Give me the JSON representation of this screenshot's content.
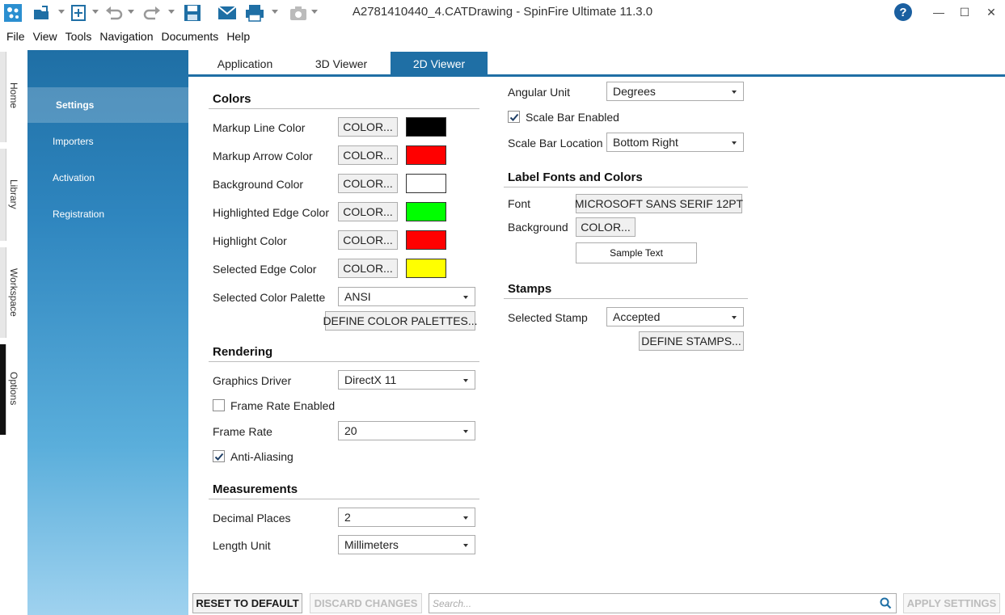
{
  "window": {
    "title": "A2781410440_4.CATDrawing - SpinFire Ultimate 11.3.0",
    "help": "?",
    "minimize": "—",
    "maximize": "☐",
    "close": "✕"
  },
  "menu": [
    "File",
    "View",
    "Tools",
    "Navigation",
    "Documents",
    "Help"
  ],
  "vnav": [
    "Home",
    "Library",
    "Workspace",
    "Options"
  ],
  "sidebar": [
    "Settings",
    "Importers",
    "Activation",
    "Registration"
  ],
  "tabs": [
    "Application",
    "3D Viewer",
    "2D Viewer"
  ],
  "colors": {
    "title": "Colors",
    "button_label": "COLOR...",
    "rows": [
      {
        "label": "Markup Line Color",
        "color": "#000000"
      },
      {
        "label": "Markup Arrow Color",
        "color": "#ff0000"
      },
      {
        "label": "Background Color",
        "color": "#ffffff"
      },
      {
        "label": "Highlighted Edge Color",
        "color": "#00ff00"
      },
      {
        "label": "Highlight Color",
        "color": "#ff0000"
      },
      {
        "label": "Selected Edge Color",
        "color": "#ffff00"
      }
    ],
    "palette_label": "Selected Color Palette",
    "palette_value": "ANSI",
    "define_palettes": "DEFINE COLOR PALETTES..."
  },
  "rendering": {
    "title": "Rendering",
    "graphics_driver_label": "Graphics Driver",
    "graphics_driver_value": "DirectX 11",
    "frame_rate_enabled_label": "Frame Rate Enabled",
    "frame_rate_enabled": false,
    "frame_rate_label": "Frame Rate",
    "frame_rate_value": "20",
    "anti_aliasing_label": "Anti-Aliasing",
    "anti_aliasing": true
  },
  "measurements": {
    "title": "Measurements",
    "decimal_places_label": "Decimal Places",
    "decimal_places_value": "2",
    "length_unit_label": "Length Unit",
    "length_unit_value": "Millimeters",
    "angular_unit_label": "Angular Unit",
    "angular_unit_value": "Degrees",
    "scale_bar_enabled_label": "Scale Bar Enabled",
    "scale_bar_enabled": true,
    "scale_bar_location_label": "Scale Bar Location",
    "scale_bar_location_value": "Bottom Right"
  },
  "label_fonts": {
    "title": "Label Fonts and Colors",
    "font_label": "Font",
    "font_value": "MICROSOFT SANS SERIF 12PT",
    "background_label": "Background",
    "background_button": "COLOR...",
    "sample_text": "Sample Text"
  },
  "stamps": {
    "title": "Stamps",
    "selected_stamp_label": "Selected Stamp",
    "selected_stamp_value": "Accepted",
    "define_stamps": "DEFINE STAMPS..."
  },
  "bottom": {
    "reset": "RESET TO DEFAULT",
    "discard": "DISCARD CHANGES",
    "search_placeholder": "Search...",
    "apply": "APPLY SETTINGS"
  }
}
